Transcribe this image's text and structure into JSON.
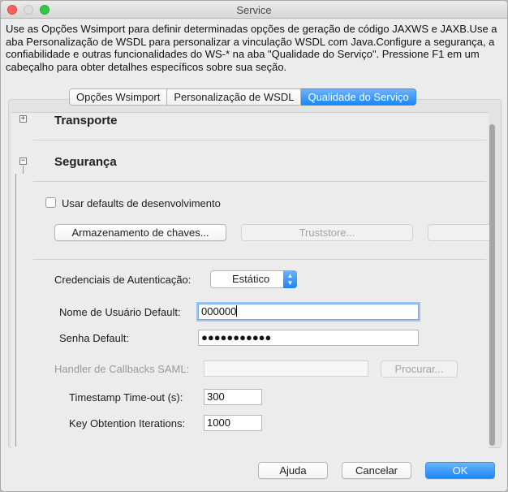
{
  "window": {
    "title": "Service"
  },
  "description": "Use as Opções Wsimport para definir determinadas opções de geração de código JAXWS e JAXB.Use a aba Personalização de WSDL para personalizar a vinculação WSDL com Java.Configure a segurança, a confiabilidade e outras funcionalidades do WS-* na aba \"Qualidade do Serviço\". Pressione F1 em um cabeçalho para obter detalhes específicos sobre sua seção.",
  "tabs": [
    {
      "label": "Opções Wsimport",
      "active": false
    },
    {
      "label": "Personalização de WSDL",
      "active": false
    },
    {
      "label": "Qualidade do Serviço",
      "active": true
    }
  ],
  "sections": {
    "transport": {
      "title": "Transporte",
      "expander": "+"
    },
    "security": {
      "title": "Segurança",
      "expander": "−"
    }
  },
  "security": {
    "dev_defaults_label": "Usar defaults de desenvolvimento",
    "dev_defaults_checked": false,
    "keystore_button": "Armazenamento de chaves...",
    "truststore_button": "Truststore...",
    "auth_label": "Credenciais de Autenticação:",
    "auth_value": "Estático",
    "username_label": "Nome de Usuário Default:",
    "username_value": "000000",
    "password_label": "Senha Default:",
    "password_value": "●●●●●●●●●●●",
    "saml_label": "Handler de Callbacks SAML:",
    "saml_value": "",
    "browse_button": "Procurar...",
    "timestamp_label": "Timestamp Time-out (s):",
    "timestamp_value": "300",
    "iterations_label": "Key Obtention Iterations:",
    "iterations_value": "1000"
  },
  "footer": {
    "help_button": "Ajuda",
    "cancel_button": "Cancelar",
    "ok_button": "OK"
  },
  "colors": {
    "accent": "#1b86f8",
    "close": "#fc605b",
    "maximize": "#34c84a"
  }
}
